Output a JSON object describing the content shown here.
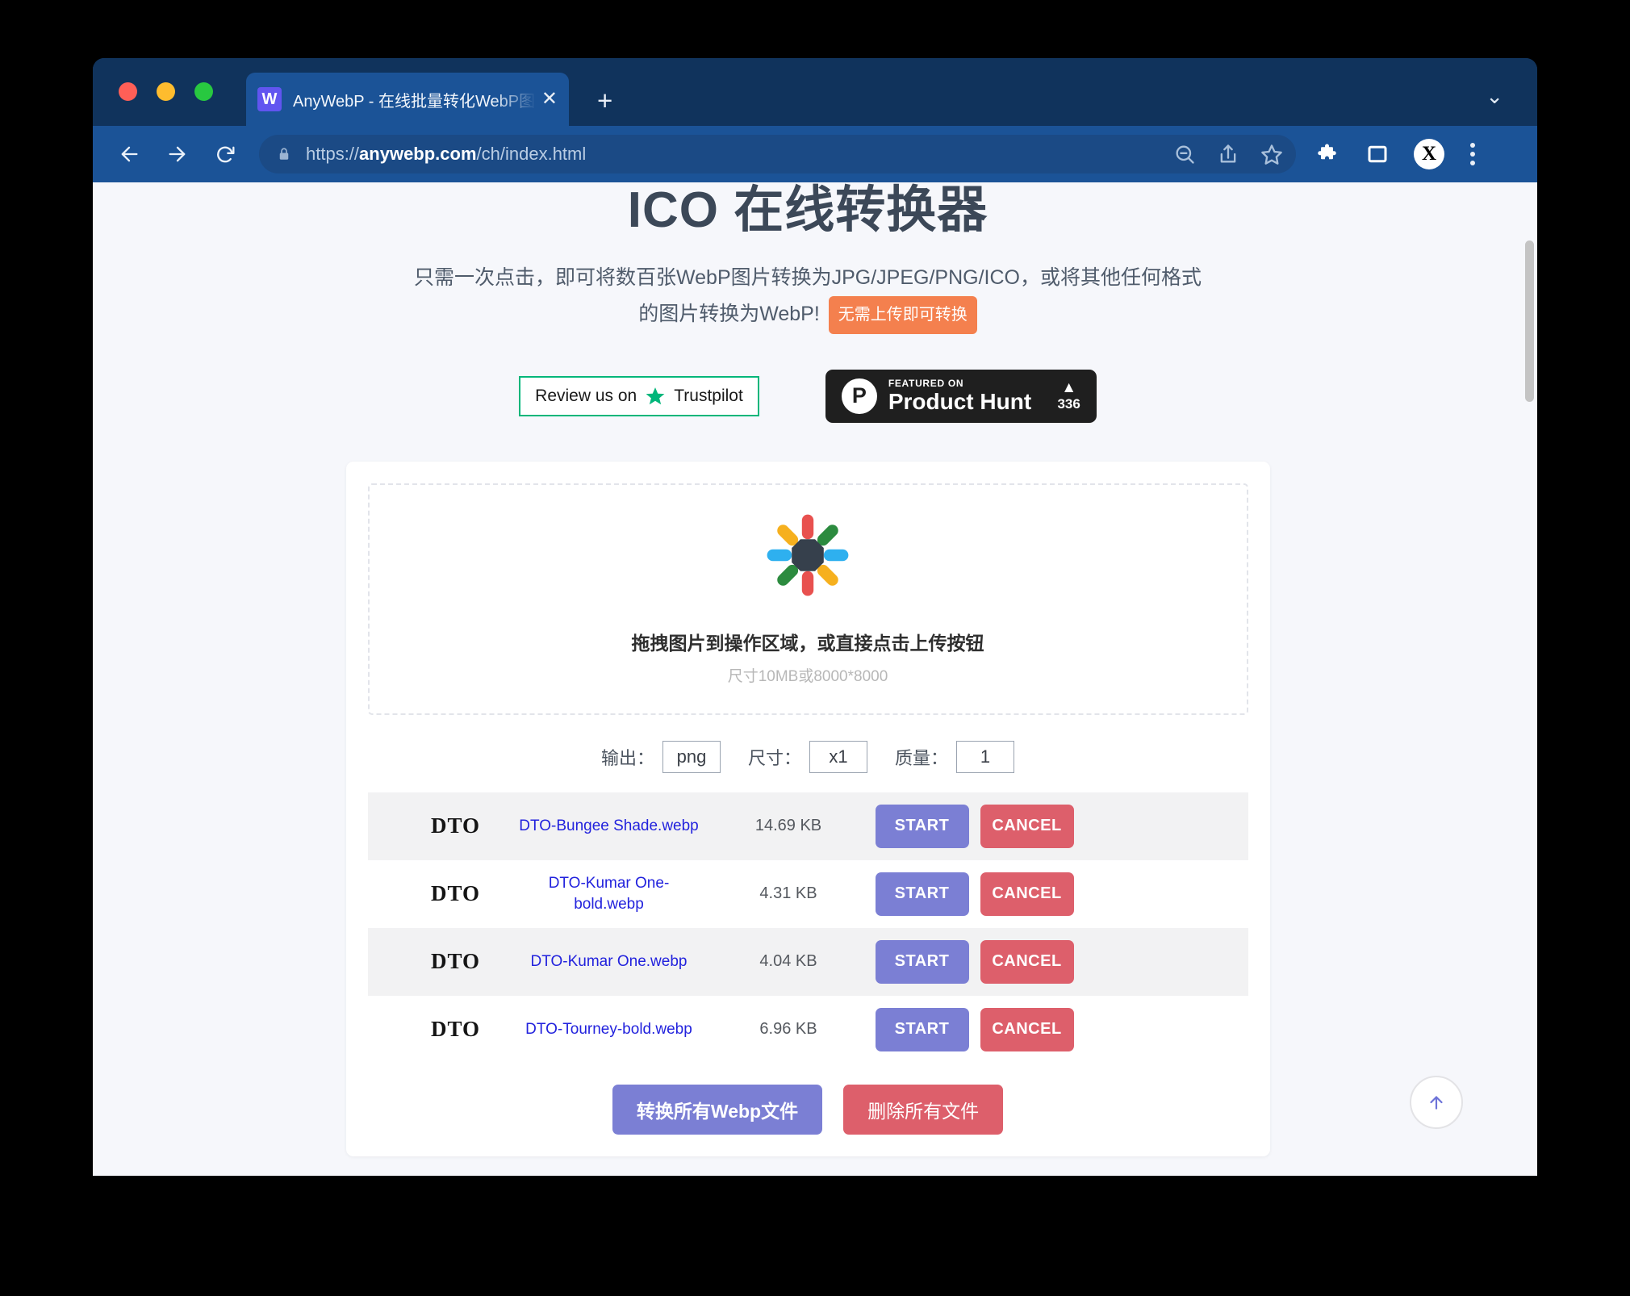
{
  "browser": {
    "tab": {
      "favicon_letter": "W",
      "title": "AnyWebP - 在线批量转化WebP图",
      "close_label": "✕"
    },
    "new_tab_label": "+",
    "tabstrip_chevron": "⌄",
    "omnibox": {
      "scheme": "https://",
      "host": "anywebp.com",
      "path": "/ch/index.html"
    },
    "avatar_letter": "X"
  },
  "page": {
    "title": "ICO 在线转换器",
    "description_line1": "只需一次点击，即可将数百张WebP图片转换为JPG/JPEG/PNG/ICO，或将其他任何格式",
    "description_line2": "的图片转换为WebP!",
    "badge_no_upload": "无需上传即可转换",
    "trustpilot_label": "Review us on",
    "trustpilot_name": "Trustpilot",
    "producthunt": {
      "featured_on": "FEATURED ON",
      "name": "Product Hunt",
      "caret": "▲",
      "count": "336"
    },
    "dropzone": {
      "main_text": "拖拽图片到操作区域，或直接点击上传按钮",
      "sub_text": "尺寸10MB或8000*8000"
    },
    "options": [
      {
        "label": "输出：",
        "value": "png",
        "name": "output-format"
      },
      {
        "label": "尺寸：",
        "value": "x1",
        "name": "output-size"
      },
      {
        "label": "质量：",
        "value": "1",
        "name": "output-quality"
      }
    ],
    "files": [
      {
        "thumb_text": "DTO",
        "name": "DTO-Bungee Shade.webp",
        "size": "14.69 KB",
        "start": "START",
        "cancel": "CANCEL"
      },
      {
        "thumb_text": "DTO",
        "name": "DTO-Kumar One-bold.webp",
        "size": "4.31 KB",
        "start": "START",
        "cancel": "CANCEL"
      },
      {
        "thumb_text": "DTO",
        "name": "DTO-Kumar One.webp",
        "size": "4.04 KB",
        "start": "START",
        "cancel": "CANCEL"
      },
      {
        "thumb_text": "DTO",
        "name": "DTO-Tourney-bold.webp",
        "size": "6.96 KB",
        "start": "START",
        "cancel": "CANCEL"
      }
    ],
    "bulk": {
      "convert_all": "转换所有Webp文件",
      "delete_all": "删除所有文件"
    }
  },
  "colors": {
    "browser_chrome": "#1b5397",
    "tabstrip": "#10335c",
    "page_bg": "#f6f7fb",
    "accent_purple": "#7b7fd4",
    "accent_red": "#dd5f6b",
    "orange_badge": "#f4804e",
    "link_blue": "#2222dd",
    "trustpilot_green": "#00b67a"
  }
}
